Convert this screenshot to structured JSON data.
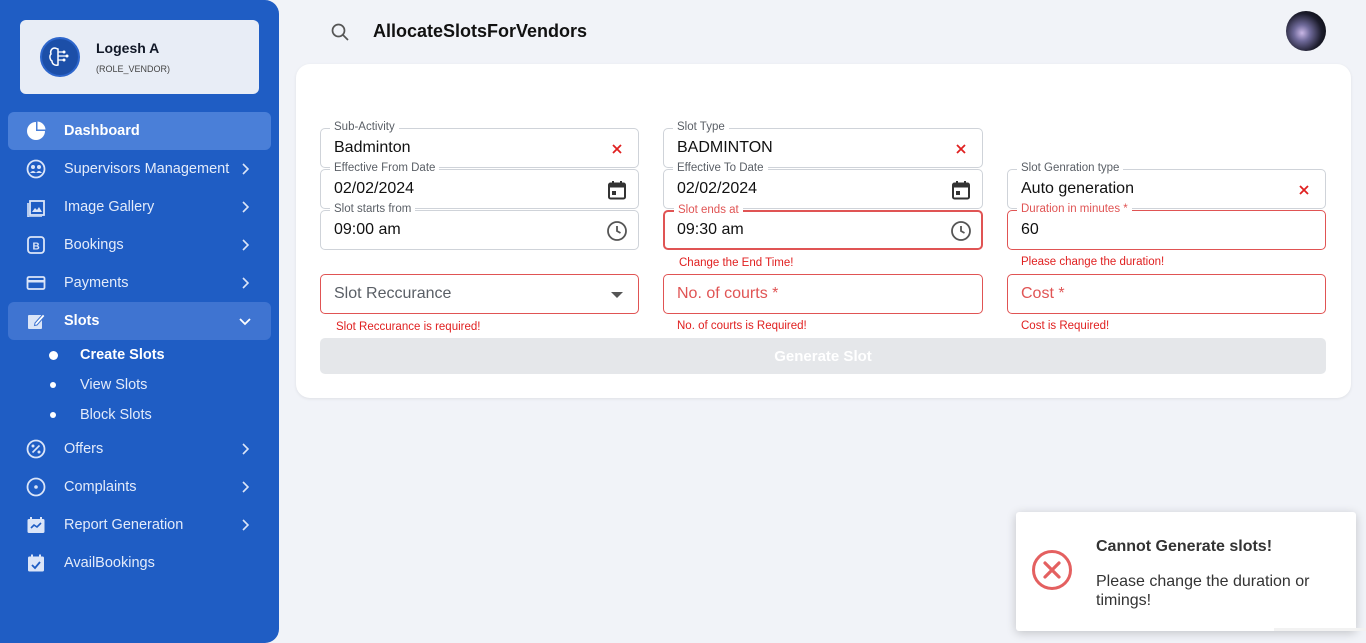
{
  "user": {
    "name": "Logesh A",
    "role": "(ROLE_VENDOR)"
  },
  "nav": {
    "items": [
      {
        "label": "Dashboard",
        "icon": "pie-chart-icon"
      },
      {
        "label": "Supervisors Management",
        "icon": "supervisor-icon"
      },
      {
        "label": "Image Gallery",
        "icon": "image-gallery-icon"
      },
      {
        "label": "Bookings",
        "icon": "bookings-icon"
      },
      {
        "label": "Payments",
        "icon": "credit-card-icon"
      },
      {
        "label": "Slots",
        "icon": "edit-note-icon"
      },
      {
        "label": "Offers",
        "icon": "offer-icon"
      },
      {
        "label": "Complaints",
        "icon": "complaint-icon"
      },
      {
        "label": "Report Generation",
        "icon": "report-icon"
      },
      {
        "label": "AvailBookings",
        "icon": "calendar-check-icon"
      }
    ],
    "slots_sub": [
      {
        "label": "Create Slots"
      },
      {
        "label": "View Slots"
      },
      {
        "label": "Block Slots"
      }
    ]
  },
  "header": {
    "title": "AllocateSlotsForVendors"
  },
  "form": {
    "sub_activity": {
      "label": "Sub-Activity",
      "value": "Badminton"
    },
    "slot_type": {
      "label": "Slot Type",
      "value": "BADMINTON"
    },
    "effective_from": {
      "label": "Effective From Date",
      "value": "02/02/2024"
    },
    "effective_to": {
      "label": "Effective To Date",
      "value": "02/02/2024"
    },
    "slot_gen_type": {
      "label": "Slot Genration type",
      "value": "Auto generation"
    },
    "slot_start": {
      "label": "Slot starts from",
      "value": "09:00 am"
    },
    "slot_end": {
      "label": "Slot ends at",
      "value": "09:30 am",
      "error": "Change the End Time!"
    },
    "duration": {
      "label": "Duration in minutes *",
      "value": "60",
      "error": "Please change the duration!"
    },
    "recurrence": {
      "placeholder": "Slot Reccurance",
      "error": "Slot Reccurance is required!"
    },
    "courts": {
      "placeholder": "No. of courts *",
      "error": "No. of courts is Required!"
    },
    "cost": {
      "placeholder": "Cost *",
      "error": "Cost is Required!"
    },
    "generate_label": "Generate Slot"
  },
  "toast": {
    "title": "Cannot Generate slots!",
    "message": "Please change the duration or timings!"
  },
  "colors": {
    "sidebar": "#1f5dc4",
    "error": "#e05454",
    "clear": "#e02020"
  }
}
